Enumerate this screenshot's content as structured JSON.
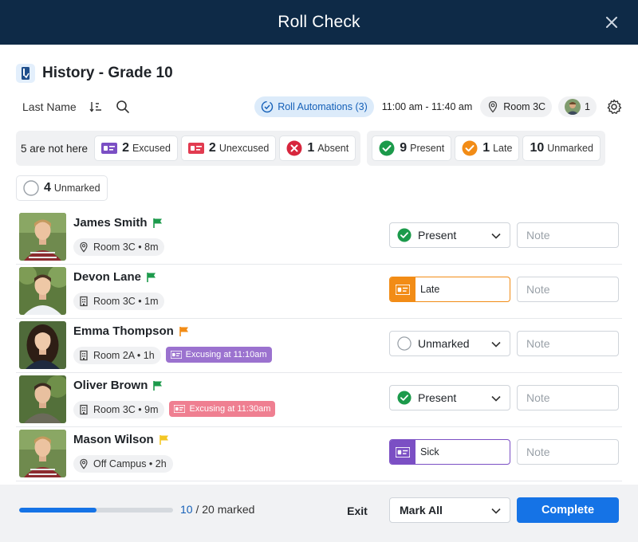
{
  "window": {
    "title": "Roll Check",
    "close_icon": "close-icon"
  },
  "class": {
    "title": "History - Grade 10"
  },
  "toolbar": {
    "sort_label": "Last Name",
    "roll_automations": "Roll Automations (3)",
    "time_range": "11:00 am - 11:40 am",
    "room": "Room 3C",
    "staff_count": "1"
  },
  "summary": {
    "not_here_label": "5 are not here",
    "excused": {
      "count": "2",
      "label": "Excused"
    },
    "unexcused": {
      "count": "2",
      "label": "Unexcused"
    },
    "absent": {
      "count": "1",
      "label": "Absent"
    },
    "present": {
      "count": "9",
      "label": "Present"
    },
    "late": {
      "count": "1",
      "label": "Late"
    },
    "unmarked_top": {
      "count": "10",
      "label": "Unmarked"
    },
    "unmarked": {
      "count": "4",
      "label": "Unmarked"
    }
  },
  "colors": {
    "header": "#0e2a47",
    "primary": "#1573e6",
    "present": "#1c9a4b",
    "late": "#f28c16",
    "absent": "#d7263d",
    "excused": "#7b4fc4",
    "unexcused": "#e23b50",
    "flag_green": "#1c9a4b",
    "flag_orange": "#f28c16",
    "flag_yellow": "#f3c623"
  },
  "students": [
    {
      "name": "James Smith",
      "flag": "green",
      "location": "Room 3C • 8m",
      "location_icon": "pin-icon",
      "excuse": "",
      "status": "Present",
      "note_placeholder": "Note"
    },
    {
      "name": "Devon Lane",
      "flag": "green",
      "location": "Room 3C • 1m",
      "location_icon": "building-icon",
      "excuse": "",
      "status": "Late",
      "note_placeholder": "Note"
    },
    {
      "name": "Emma Thompson",
      "flag": "orange",
      "location": "Room 2A • 1h",
      "location_icon": "building-icon",
      "excuse": "Excusing at 11:10am",
      "status": "Unmarked",
      "note_placeholder": "Note"
    },
    {
      "name": "Oliver Brown",
      "flag": "green",
      "location": "Room 3C • 9m",
      "location_icon": "building-icon",
      "excuse": "Excusing at 11:30am",
      "status": "Present",
      "note_placeholder": "Note"
    },
    {
      "name": "Mason Wilson",
      "flag": "yellow",
      "location": "Off Campus • 2h",
      "location_icon": "pin-icon",
      "excuse": "",
      "status": "Sick",
      "note_placeholder": "Note"
    }
  ],
  "footer": {
    "progress_fraction": 0.5,
    "marked_count": "10",
    "marked_rest": "/ 20 marked",
    "exit_label": "Exit",
    "mark_all_label": "Mark All",
    "complete_label": "Complete"
  }
}
